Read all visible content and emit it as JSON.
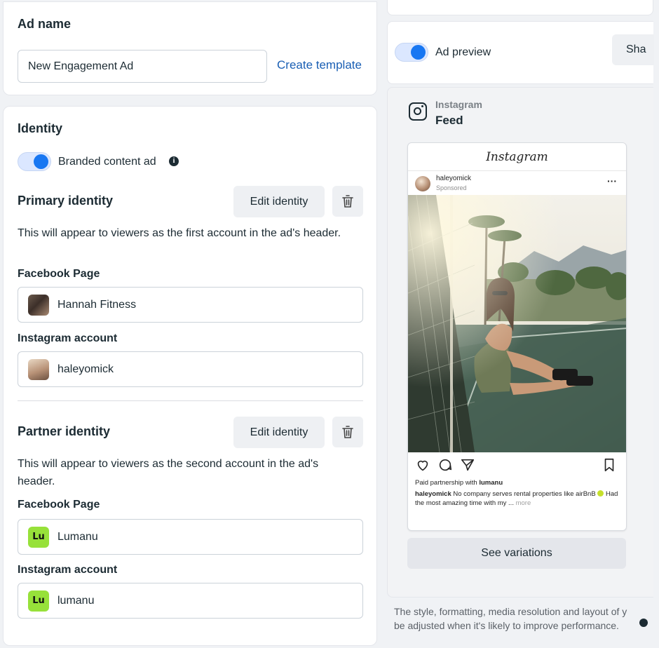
{
  "ad_name": {
    "title": "Ad name",
    "input_value": "New Engagement Ad",
    "create_template_label": "Create template"
  },
  "identity": {
    "title": "Identity",
    "branded_content_label": "Branded content ad",
    "branded_content_on": true,
    "primary": {
      "title": "Primary identity",
      "edit_label": "Edit identity",
      "description": "This will appear to viewers as the first account in the ad's header.",
      "facebook_page_label": "Facebook Page",
      "facebook_page_value": "Hannah Fitness",
      "instagram_label": "Instagram account",
      "instagram_value": "haleyomick"
    },
    "partner": {
      "title": "Partner identity",
      "edit_label": "Edit identity",
      "description": "This will appear to viewers as the second account in the ad's header.",
      "facebook_page_label": "Facebook Page",
      "facebook_page_value": "Lumanu",
      "instagram_label": "Instagram account",
      "instagram_value": "lumanu",
      "logo_text": "Lu"
    }
  },
  "preview": {
    "toggle_label": "Ad preview",
    "toggle_on": true,
    "share_label": "Sha",
    "platform": "Instagram",
    "placement": "Feed",
    "phone": {
      "app_title": "Instagram",
      "username": "haleyomick",
      "sponsored": "Sponsored",
      "more": "···",
      "paid_partnership_prefix": "Paid partnership with ",
      "paid_partnership_name": "lumanu",
      "caption_user": "haleyomick",
      "caption_text_1": " No company serves rental properties like airBnB ",
      "caption_text_2": " Had the most amazing time with my ...",
      "caption_more": " more"
    },
    "variations_label": "See variations",
    "footer_note_line1": "The style, formatting, media resolution and layout of y",
    "footer_note_line2": "be adjusted when it's likely to improve performance."
  },
  "colors": {
    "accent": "#1877f2",
    "link": "#1a5fb4",
    "lumanu_logo": "#97e13a"
  },
  "icons": [
    "info-icon",
    "trash-icon",
    "instagram-icon",
    "heart-icon",
    "comment-icon",
    "share-icon",
    "bookmark-icon"
  ]
}
